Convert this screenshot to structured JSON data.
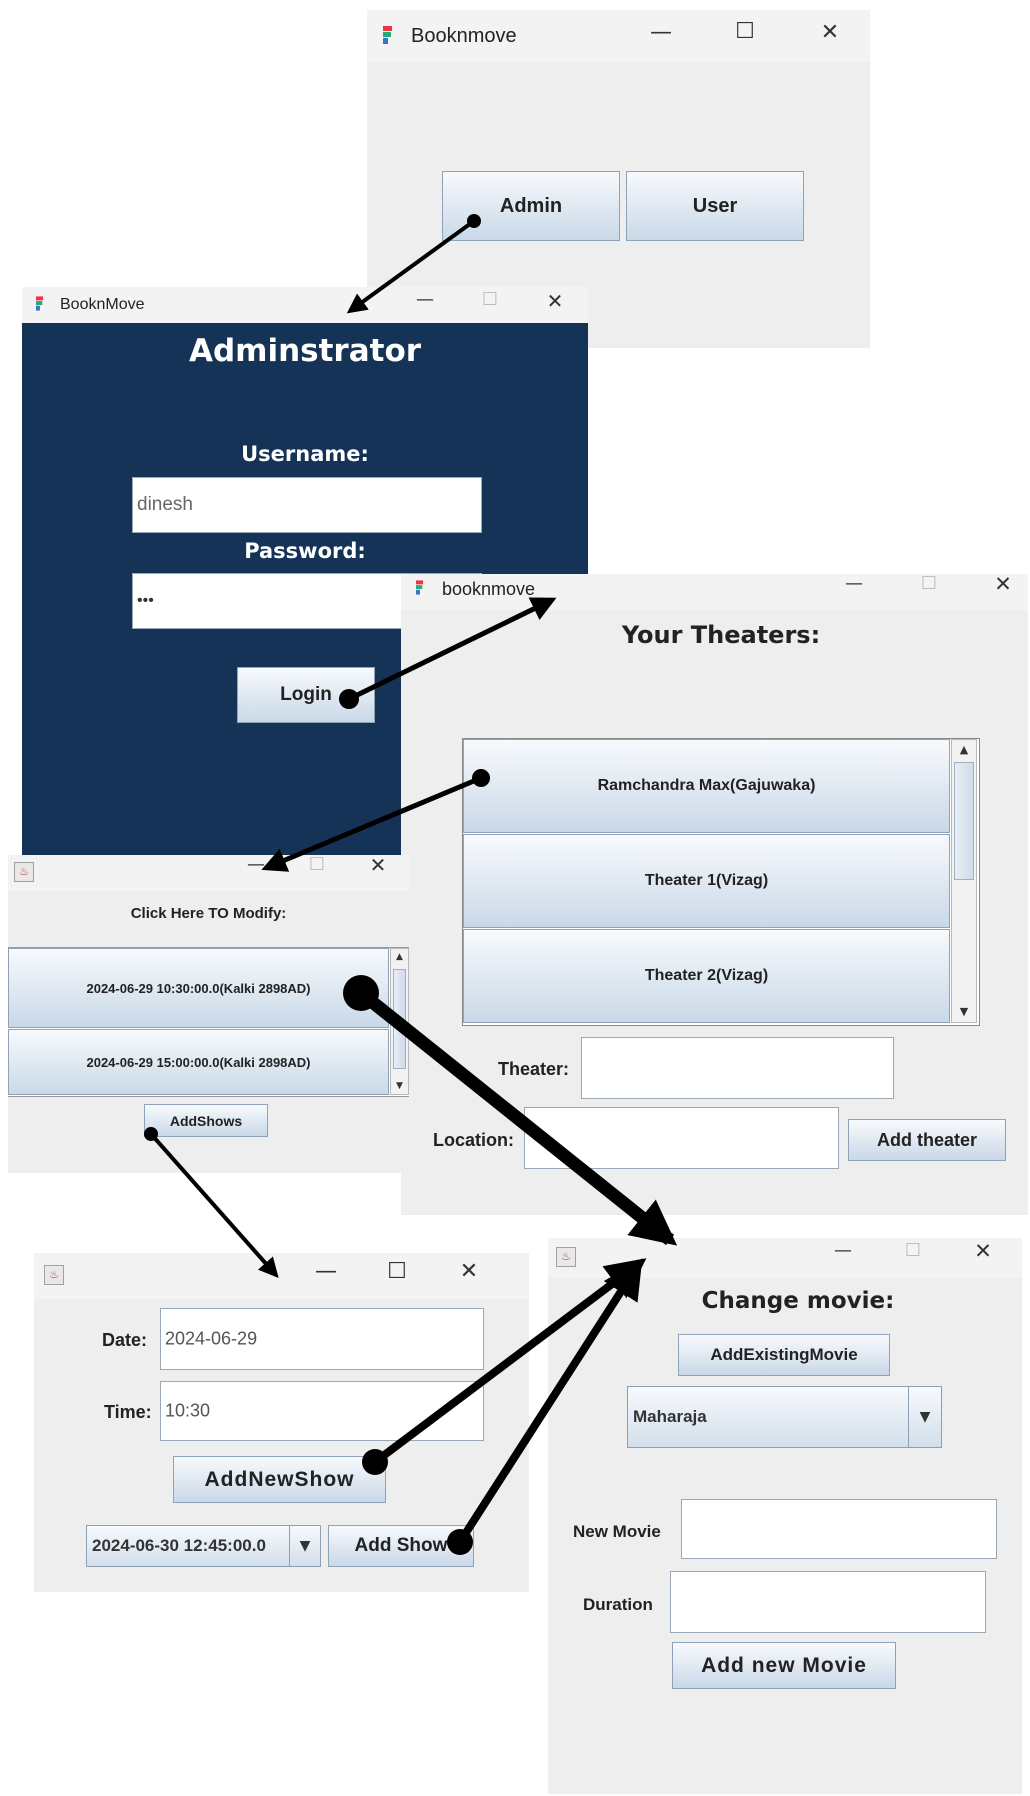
{
  "win_main": {
    "title": "Booknmove",
    "buttons": {
      "admin": "Admin",
      "user": "User"
    }
  },
  "win_admin": {
    "title": "BooknMove",
    "heading": "Adminstrator",
    "username_label": "Username:",
    "username_value": "dinesh",
    "password_label": "Password:",
    "password_value": "•••",
    "login_button": "Login"
  },
  "win_theaters": {
    "title": "booknmove",
    "heading": "Your Theaters:",
    "theaters": [
      "Ramchandra Max(Gajuwaka)",
      "Theater 1(Vizag)",
      "Theater 2(Vizag)"
    ],
    "theater_label": "Theater:",
    "location_label": "Location:",
    "add_theater_button": "Add theater"
  },
  "win_shows": {
    "heading": "Click Here TO Modify:",
    "shows": [
      "2024-06-29 10:30:00.0(Kalki 2898AD)",
      "2024-06-29 15:00:00.0(Kalki 2898AD)"
    ],
    "add_shows_button": "AddShows"
  },
  "win_addshow": {
    "date_label": "Date:",
    "date_value": "2024-06-29",
    "time_label": "Time:",
    "time_value": "10:30",
    "add_new_show_button": "AddNewShow",
    "select_value": "2024-06-30 12:45:00.0",
    "add_show_button": "Add Show"
  },
  "win_movie": {
    "heading": "Change movie:",
    "add_existing_button": "AddExistingMovie",
    "select_value": "Maharaja",
    "new_movie_label": "New Movie",
    "duration_label": "Duration",
    "add_new_movie_button": "Add new Movie"
  },
  "colors": {
    "admin_bg": "#153356",
    "window_bg": "#eeeeee",
    "arrow": "#000000"
  }
}
